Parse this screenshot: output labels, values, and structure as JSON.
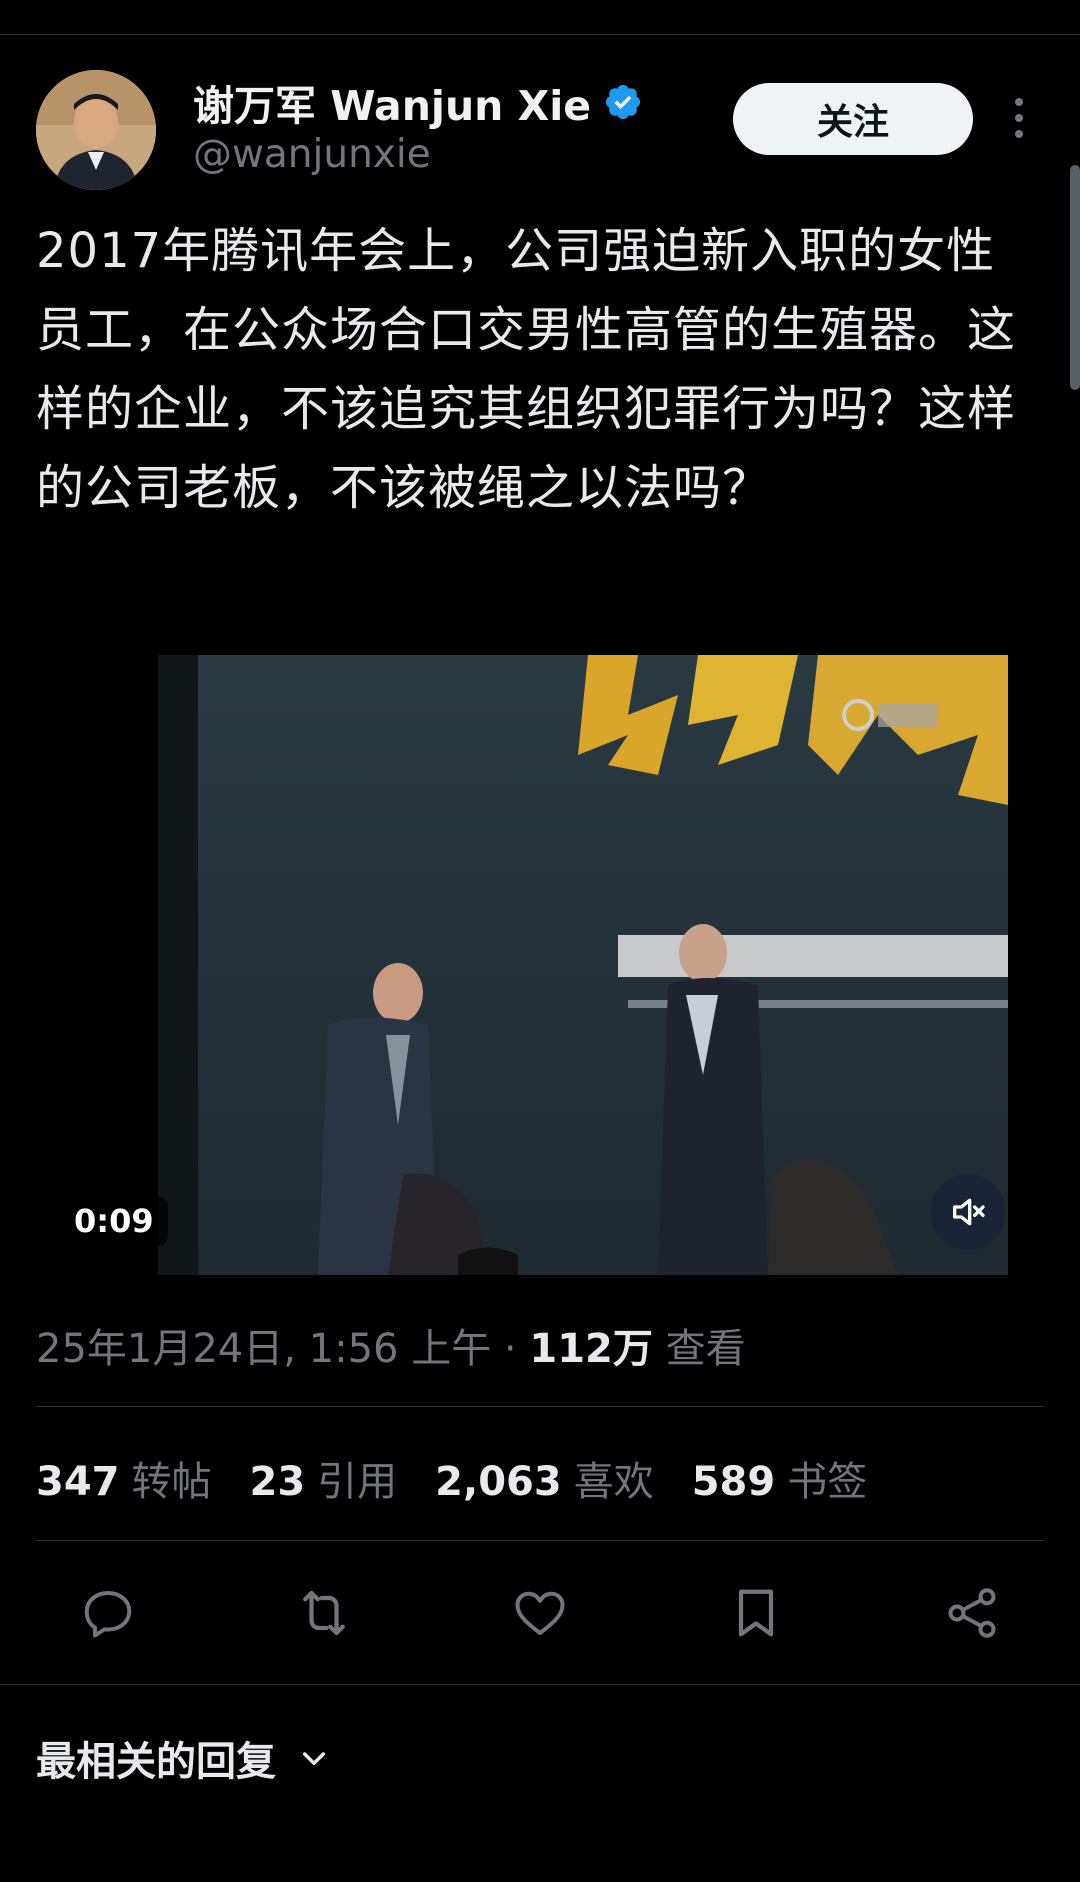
{
  "author": {
    "display_name": "谢万军 Wanjun Xie",
    "handle": "@wanjunxie",
    "verified_color": "#1d9bf0"
  },
  "follow_button": {
    "label": "关注"
  },
  "tweet": {
    "text": "2017年腾讯年会上，公司强迫新入职的女性员工，在公众场合口交男性高管的生殖器。这样的企业，不该追究其组织犯罪行为吗？这样的公司老板，不该被绳之以法吗？"
  },
  "video": {
    "timestamp": "0:09",
    "muted": true
  },
  "meta": {
    "datetime": "25年1月24日, 1:56 上午",
    "separator": " · ",
    "views_count": "112万",
    "views_label": " 查看"
  },
  "stats": [
    {
      "count": "347",
      "label": "转帖"
    },
    {
      "count": "23",
      "label": "引用"
    },
    {
      "count": "2,063",
      "label": "喜欢"
    },
    {
      "count": "589",
      "label": "书签"
    }
  ],
  "actions": [
    "reply-icon",
    "retweet-icon",
    "like-icon",
    "bookmark-icon",
    "share-icon"
  ],
  "replies_sort": {
    "label": "最相关的回复"
  },
  "colors": {
    "background": "#000000",
    "primary_text": "#e7e9ea",
    "secondary_text": "#71767b",
    "divider": "#2f3336",
    "follow_button_bg": "#eff3f4"
  }
}
